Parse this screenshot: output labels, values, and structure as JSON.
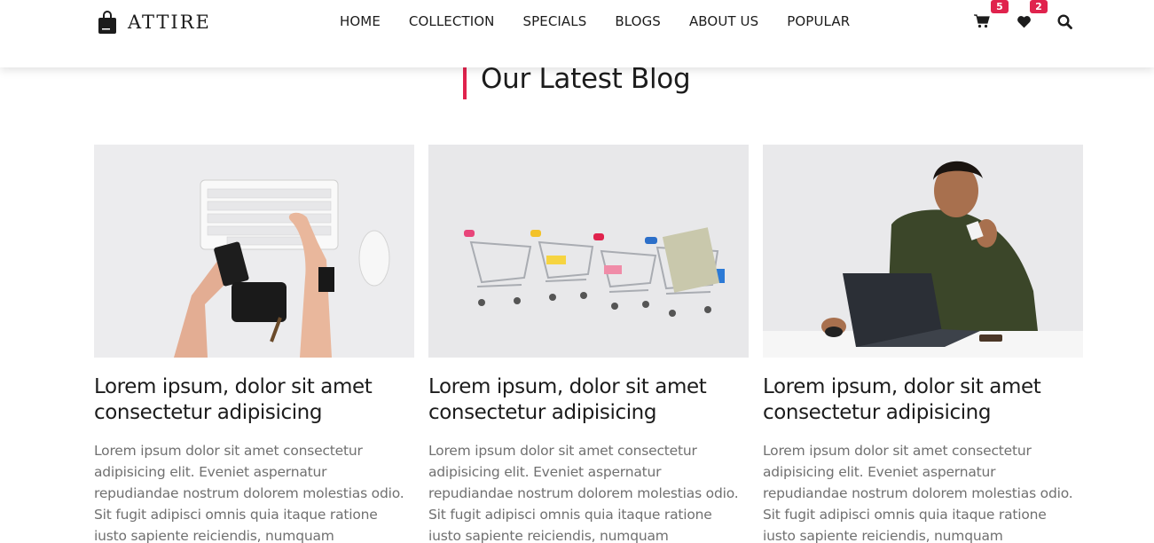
{
  "header": {
    "brand": "ATTIRE",
    "nav": [
      "HOME",
      "COLLECTION",
      "SPECIALS",
      "BLOGS",
      "ABOUT US",
      "POPULAR"
    ],
    "cart_count": "5",
    "wishlist_count": "2",
    "icons": [
      "bag-logo-icon",
      "cart-icon",
      "heart-icon",
      "search-icon"
    ]
  },
  "section": {
    "title": "Our Latest Blog"
  },
  "posts": [
    {
      "title": "Lorem ipsum, dolor sit amet consectetur adipisicing",
      "text": "Lorem ipsum dolor sit amet consectetur adipisicing elit. Eveniet aspernatur repudiandae nostrum dolorem molestias odio. Sit fugit adipisci omnis quia itaque ratione iusto sapiente reiciendis, numquam",
      "image": "hands-with-credit-card-and-keyboard"
    },
    {
      "title": "Lorem ipsum, dolor sit amet consectetur adipisicing",
      "text": "Lorem ipsum dolor sit amet consectetur adipisicing elit. Eveniet aspernatur repudiandae nostrum dolorem molestias odio. Sit fugit adipisci omnis quia itaque ratione iusto sapiente reiciendis, numquam",
      "image": "mini-shopping-carts-with-money"
    },
    {
      "title": "Lorem ipsum, dolor sit amet consectetur adipisicing",
      "text": "Lorem ipsum dolor sit amet consectetur adipisicing elit. Eveniet aspernatur repudiandae nostrum dolorem molestias odio. Sit fugit adipisci omnis quia itaque ratione iusto sapiente reiciendis, numquam",
      "image": "man-with-laptop-holding-card"
    }
  ],
  "colors": {
    "accent": "#e0234d",
    "text": "#1c1c1c",
    "muted": "#707070"
  }
}
